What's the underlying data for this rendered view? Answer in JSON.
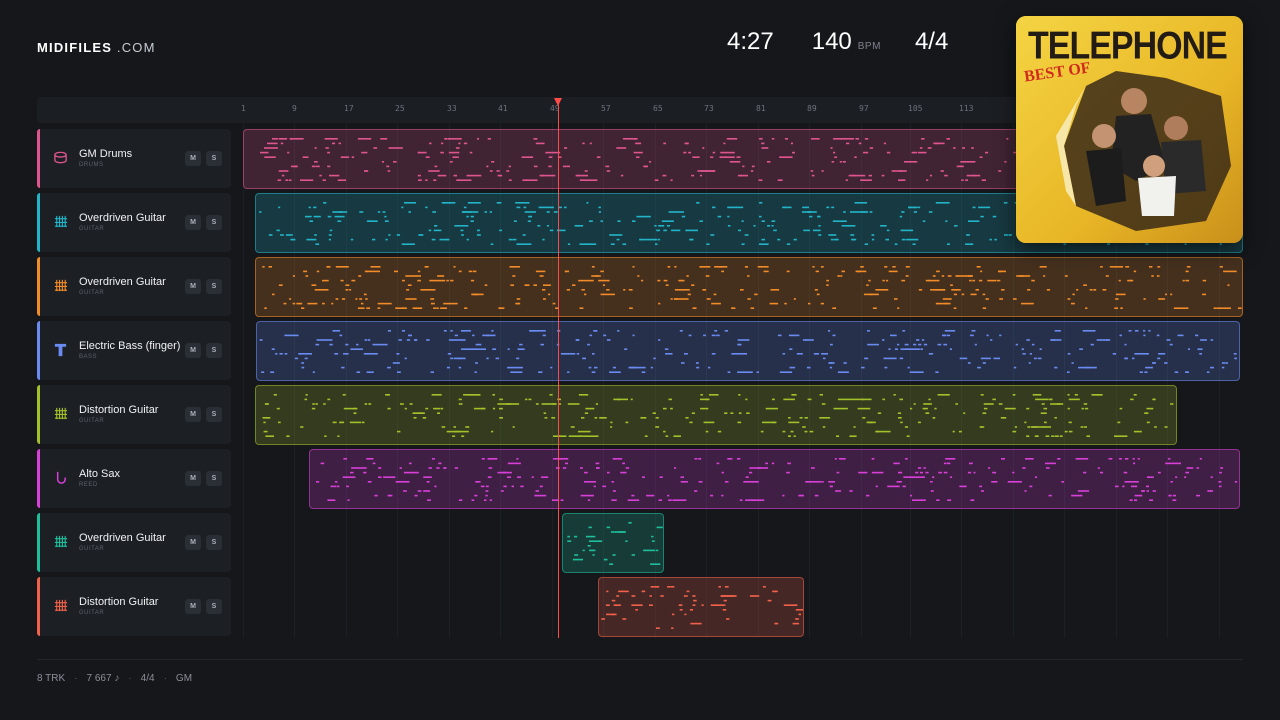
{
  "brand": {
    "name": "MIDIFILES",
    "suffix": ".COM"
  },
  "stats": {
    "duration": "4:27",
    "bpm": "140",
    "bpm_label": "BPM",
    "time_signature": "4/4"
  },
  "cover": {
    "title": "TELEPHONE",
    "subtitle": "BEST OF"
  },
  "ruler": {
    "ticks": [
      "1",
      "9",
      "17",
      "25",
      "33",
      "41",
      "49",
      "57",
      "65",
      "73",
      "81",
      "89",
      "97",
      "105",
      "113"
    ]
  },
  "tracks": [
    {
      "name": "GM Drums",
      "category": "DRUMS",
      "color": "#e0558f",
      "icon": "drum-icon",
      "mute": "M",
      "solo": "S"
    },
    {
      "name": "Overdriven Guitar",
      "category": "GUITAR",
      "color": "#22b5c9",
      "icon": "guitar-icon",
      "mute": "M",
      "solo": "S"
    },
    {
      "name": "Overdriven Guitar",
      "category": "GUITAR",
      "color": "#f28c28",
      "icon": "guitar-icon",
      "mute": "M",
      "solo": "S"
    },
    {
      "name": "Electric Bass (finger)",
      "category": "BASS",
      "color": "#6a8cf2",
      "icon": "bass-icon",
      "mute": "M",
      "solo": "S"
    },
    {
      "name": "Distortion Guitar",
      "category": "GUITAR",
      "color": "#a3c12a",
      "icon": "guitar-icon",
      "mute": "M",
      "solo": "S"
    },
    {
      "name": "Alto Sax",
      "category": "REED",
      "color": "#d93fd9",
      "icon": "sax-icon",
      "mute": "M",
      "solo": "S"
    },
    {
      "name": "Overdriven Guitar",
      "category": "GUITAR",
      "color": "#1fbf9c",
      "icon": "guitar-icon",
      "mute": "M",
      "solo": "S"
    },
    {
      "name": "Distortion Guitar",
      "category": "GUITAR",
      "color": "#f2624a",
      "icon": "guitar-icon",
      "mute": "M",
      "solo": "S"
    }
  ],
  "footer": {
    "tracks": "8 TRK",
    "notes": "7 667 ♪",
    "signature": "4/4",
    "standard": "GM"
  }
}
